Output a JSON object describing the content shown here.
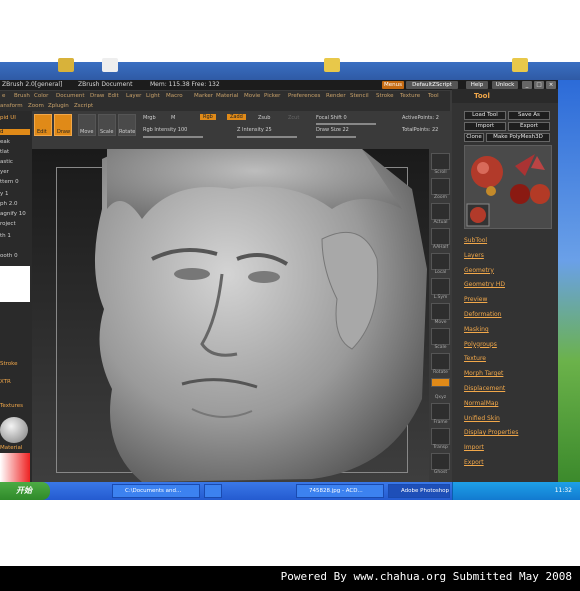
{
  "titlebar": {
    "app": "ZBrush 2.0[general]",
    "document": "ZBrush Document",
    "mem": "Mem: 115.38 Free: 132",
    "buttons": [
      "Menus",
      "DefaultZScript",
      "Help",
      "Unlock"
    ]
  },
  "menubar": {
    "row1": [
      "e",
      "Brush",
      "Color",
      "Document",
      "Draw",
      "Edit",
      "Layer",
      "Light",
      "Macro",
      "Marker",
      "Material",
      "Movie",
      "Picker",
      "Preferences",
      "Render",
      "Stencil",
      "Stroke",
      "Texture",
      "Tool"
    ],
    "row2": [
      "ansform",
      "Zoom",
      "Zplugin",
      "Zscript"
    ]
  },
  "lefttray": {
    "items": [
      "pid UI",
      "d",
      "eak",
      "tlat",
      "astic",
      "yer",
      "ttern 0",
      "y 1",
      "ph 2.0",
      "agnify 10",
      "roject",
      "th 1",
      "ooth 0",
      "Stroke",
      "XTR",
      "Textures",
      "Material"
    ]
  },
  "shelf": {
    "buttons": [
      "Edit",
      "Draw",
      "Move",
      "Scale",
      "Rotate"
    ],
    "mrgb": "Mrgb",
    "m": "M",
    "rgb": "Rgb",
    "zadd": "Zadd",
    "zsub": "Zsub",
    "zcut": "Zcut",
    "rgb_intensity": "Rgb Intensity 100",
    "z_intensity": "Z Intensity 25",
    "focal_shift": "Focal Shift 0",
    "draw_size": "Draw Size 22",
    "active_points": "ActivePoints: 2",
    "total_points": "TotalPoints: 22"
  },
  "rcol": {
    "labels": [
      "Scroll",
      "Zoom",
      "Actual",
      "AAHalf",
      "Local",
      "L.Sym",
      "Move",
      "Scale",
      "Rotate",
      "Qxyz",
      "Frame",
      "Transp",
      "Ghost"
    ]
  },
  "toolpalette": {
    "title": "Tool",
    "buttons": [
      "Load Tool",
      "Save As",
      "Import",
      "Export",
      "Clone",
      "Make PolyMesh3D"
    ],
    "subpalettes": [
      "SubTool",
      "Layers",
      "Geometry",
      "Geometry HD",
      "Preview",
      "Deformation",
      "Masking",
      "Polygroups",
      "Texture",
      "Morph Target",
      "Displacement",
      "NormalMap",
      "Unified Skin",
      "Display Properties",
      "Import",
      "Export"
    ]
  },
  "taskbar": {
    "start": "开始",
    "tasks": [
      "C:\\Documents and...",
      "",
      "745828.jpg - ACD...",
      "Adobe Photoshop ..."
    ],
    "clock": "11:32"
  },
  "footer": "Powered By www.chahua.org  Submitted May 2008"
}
